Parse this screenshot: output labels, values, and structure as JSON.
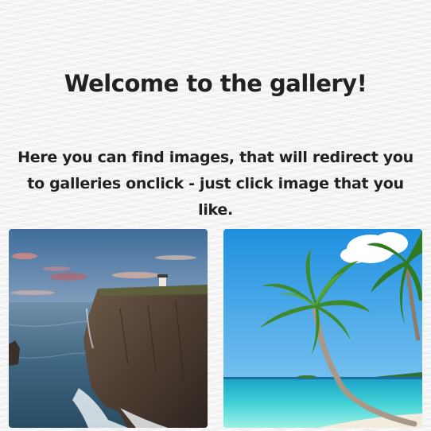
{
  "gallery": {
    "title": "Welcome to the gallery!",
    "intro": "Here you can find images, that will redirect you to galleries onclick - just click image that you like."
  },
  "cards": [
    {
      "image": "cliff-lighthouse-sea-photo"
    },
    {
      "image": "tropical-palm-beach-photo"
    }
  ]
}
